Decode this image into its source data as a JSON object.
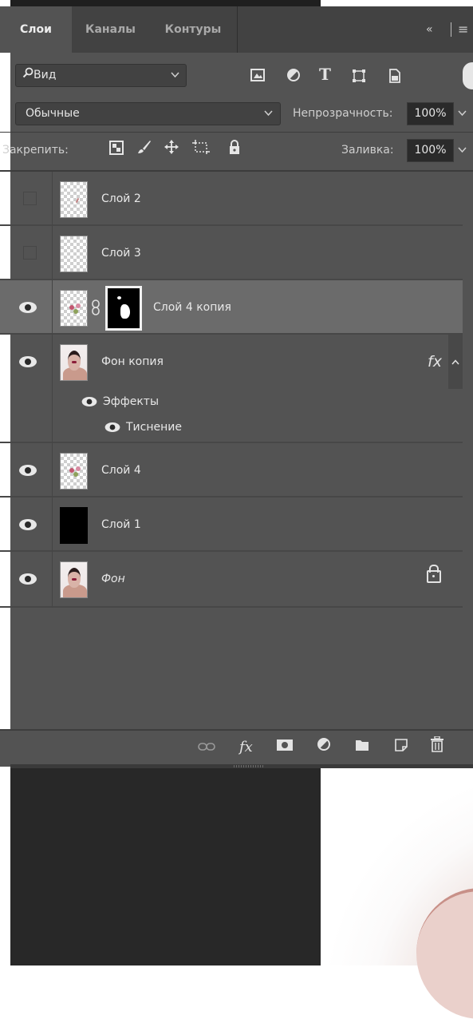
{
  "tabs": [
    {
      "label": "Слои",
      "active": true
    },
    {
      "label": "Каналы",
      "active": false
    },
    {
      "label": "Контуры",
      "active": false
    }
  ],
  "header": {
    "collapse_icon": "«",
    "menu_icon": "≡"
  },
  "filter": {
    "label": "Вид",
    "icons": [
      "image-filter-icon",
      "adjustment-filter-icon",
      "type-filter-icon",
      "shape-filter-icon",
      "smart-object-filter-icon"
    ]
  },
  "blend": {
    "mode": "Обычные",
    "opacity_label": "Непрозрачность:",
    "opacity_value": "100%"
  },
  "lock": {
    "label": "Закрепить:",
    "fill_label": "Заливка:",
    "fill_value": "100%"
  },
  "layers": [
    {
      "name": "Слой 2",
      "visible": false
    },
    {
      "name": "Слой 3",
      "visible": false
    },
    {
      "name": "Слой 4 копия",
      "visible": true,
      "selected": true,
      "has_mask": true
    },
    {
      "name": "Фон копия",
      "visible": true,
      "fx": "fx",
      "effects_label": "Эффекты",
      "effects": [
        "Тиснение"
      ]
    },
    {
      "name": "Слой 4",
      "visible": true
    },
    {
      "name": "Слой 1",
      "visible": true
    },
    {
      "name": "Фон",
      "visible": true,
      "locked": true
    }
  ],
  "footer": {
    "icons": [
      "link-layers-icon",
      "fx-icon",
      "add-mask-icon",
      "adjustment-layer-icon",
      "new-group-icon",
      "new-layer-icon",
      "delete-layer-icon"
    ],
    "fx_label": "fx"
  }
}
